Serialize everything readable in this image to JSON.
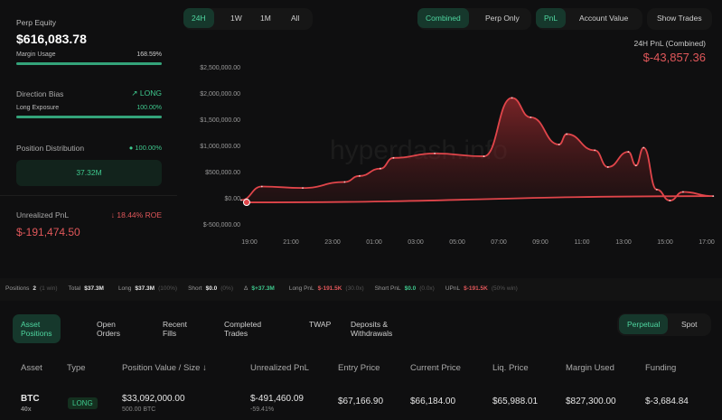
{
  "summary": {
    "perp_equity_label": "Perp Equity",
    "perp_equity": "$616,083.78",
    "margin_usage_label": "Margin Usage",
    "margin_usage": "168.59%",
    "margin_usage_fill": 1.0,
    "direction_bias_label": "Direction Bias",
    "direction_bias": "LONG",
    "long_exposure_label": "Long Exposure",
    "long_exposure": "100.00%",
    "long_exposure_fill": 1.0,
    "position_distribution_label": "Position Distribution",
    "position_distribution": "100.00%",
    "distribution_value": "37.32M",
    "unrealized_pnl_label": "Unrealized PnL",
    "roe": "18.44% ROE",
    "unrealized_pnl": "$-191,474.50"
  },
  "range_tabs": [
    "24H",
    "1W",
    "1M",
    "All"
  ],
  "range_active": "24H",
  "view_tabs": [
    "Combined",
    "Perp Only"
  ],
  "view_active": "Combined",
  "metric_tabs": [
    "PnL",
    "Account Value"
  ],
  "metric_active": "PnL",
  "show_trades": "Show Trades",
  "pnl_header": {
    "label": "24H PnL (Combined)",
    "value": "$-43,857.36"
  },
  "watermark": "hyperdash.info",
  "chart_data": {
    "type": "area",
    "ylim": [
      -500000,
      2500000
    ],
    "yticks": [
      "$2,500,000.00",
      "$2,000,000.00",
      "$1,500,000.00",
      "$1,000,000.00",
      "$500,000.00",
      "$0.00",
      "$-500,000.00"
    ],
    "ytick_values": [
      2500000,
      2000000,
      1500000,
      1000000,
      500000,
      0,
      -500000
    ],
    "xticks": [
      "19:00",
      "21:00",
      "23:00",
      "01:00",
      "03:00",
      "05:00",
      "07:00",
      "09:00",
      "11:00",
      "13:00",
      "15:00",
      "17:00"
    ],
    "x": [
      "18:36",
      "19:36",
      "21:34",
      "23:35",
      "00:18",
      "01:18",
      "01:56",
      "03:55",
      "06:17",
      "07:38",
      "08:32",
      "09:54",
      "10:16",
      "11:37",
      "12:15",
      "13:14",
      "13:36",
      "13:58",
      "14:36",
      "15:14",
      "15:52",
      "17:19",
      "18:52"
    ],
    "values": [
      0,
      259000,
      230000,
      345000,
      460000,
      600000,
      805000,
      890000,
      835000,
      1950000,
      1580000,
      1060000,
      1260000,
      950000,
      630000,
      920000,
      660000,
      1000000,
      200000,
      -10000,
      155000,
      75000,
      -43857
    ],
    "color": "#e0454a"
  },
  "stats": [
    {
      "label": "Positions",
      "value": "2",
      "note": "(1 win)",
      "color": "#e6e6e6"
    },
    {
      "label": "Total",
      "value": "$37.3M",
      "note": "",
      "color": "#e6e6e6"
    },
    {
      "label": "Long",
      "value": "$37.3M",
      "note": "(100%)",
      "color": "#e6e6e6"
    },
    {
      "label": "Short",
      "value": "$0.0",
      "note": "(0%)",
      "color": "#e6e6e6"
    },
    {
      "label": "Δ",
      "value": "$+37.3M",
      "note": "",
      "color": "#3ec98e"
    },
    {
      "label": "Long PnL",
      "value": "$-191.5K",
      "note": "(30.0x)",
      "color": "#e0575a"
    },
    {
      "label": "Short PnL",
      "value": "$0.0",
      "note": "(0.0x)",
      "color": "#3ec98e"
    },
    {
      "label": "UPnL",
      "value": "$-191.5K",
      "note": "(50% win)",
      "color": "#e0575a"
    }
  ],
  "tabs": [
    "Asset Positions",
    "Open Orders",
    "Recent Fills",
    "Completed Trades",
    "TWAP",
    "Deposits & Withdrawals"
  ],
  "tab_active": "Asset Positions",
  "market_tabs": [
    "Perpetual",
    "Spot"
  ],
  "market_active": "Perpetual",
  "table": {
    "headers": [
      "Asset",
      "Type",
      "Position Value / Size ↓",
      "Unrealized PnL",
      "Entry Price",
      "Current Price",
      "Liq. Price",
      "Margin Used",
      "Funding"
    ],
    "rows": [
      {
        "asset": "BTC",
        "leverage": "40x",
        "type": "LONG",
        "value": "$33,092,000.00",
        "size": "500.00 BTC",
        "upnl": "$-491,460.09",
        "upnl_pct": "-59.41%",
        "entry": "$67,166.90",
        "current": "$66,184.00",
        "liq": "$65,988.01",
        "margin": "$827,300.00",
        "funding": "$-3,684.84"
      }
    ]
  }
}
